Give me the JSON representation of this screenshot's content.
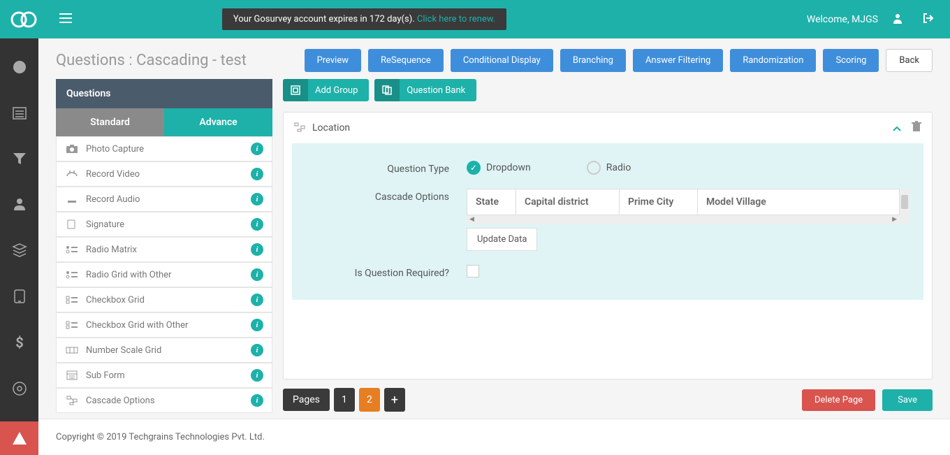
{
  "topbar": {
    "notification_text": "Your Gosurvey account expires in 172 day(s). ",
    "notification_link": "Click here to renew.",
    "welcome": "Welcome, MJGS"
  },
  "page": {
    "title": "Questions : Cascading - test"
  },
  "header_buttons": {
    "preview": "Preview",
    "resequence": "ReSequence",
    "conditional": "Conditional Display",
    "branching": "Branching",
    "filtering": "Answer Filtering",
    "randomization": "Randomization",
    "scoring": "Scoring",
    "back": "Back"
  },
  "left_panel": {
    "title": "Questions",
    "tab_standard": "Standard",
    "tab_advance": "Advance",
    "items": [
      {
        "label": "Photo Capture"
      },
      {
        "label": "Record Video"
      },
      {
        "label": "Record Audio"
      },
      {
        "label": "Signature"
      },
      {
        "label": "Radio Matrix"
      },
      {
        "label": "Radio Grid with Other"
      },
      {
        "label": "Checkbox Grid"
      },
      {
        "label": "Checkbox Grid with Other"
      },
      {
        "label": "Number Scale Grid"
      },
      {
        "label": "Sub Form"
      },
      {
        "label": "Cascade Options"
      }
    ]
  },
  "toolbar": {
    "add_group": "Add Group",
    "question_bank": "Question Bank"
  },
  "card": {
    "title": "Location",
    "question_type_label": "Question Type",
    "opt_dropdown": "Dropdown",
    "opt_radio": "Radio",
    "cascade_label": "Cascade Options",
    "cascade_cols": [
      "State",
      "Capital district",
      "Prime City",
      "Model Village"
    ],
    "update_btn": "Update Data",
    "required_label": "Is Question Required?"
  },
  "bottom": {
    "pages_label": "Pages",
    "page1": "1",
    "page2": "2",
    "delete": "Delete Page",
    "save": "Save"
  },
  "footer": "Copyright © 2019 Techgrains Technologies Pvt. Ltd."
}
